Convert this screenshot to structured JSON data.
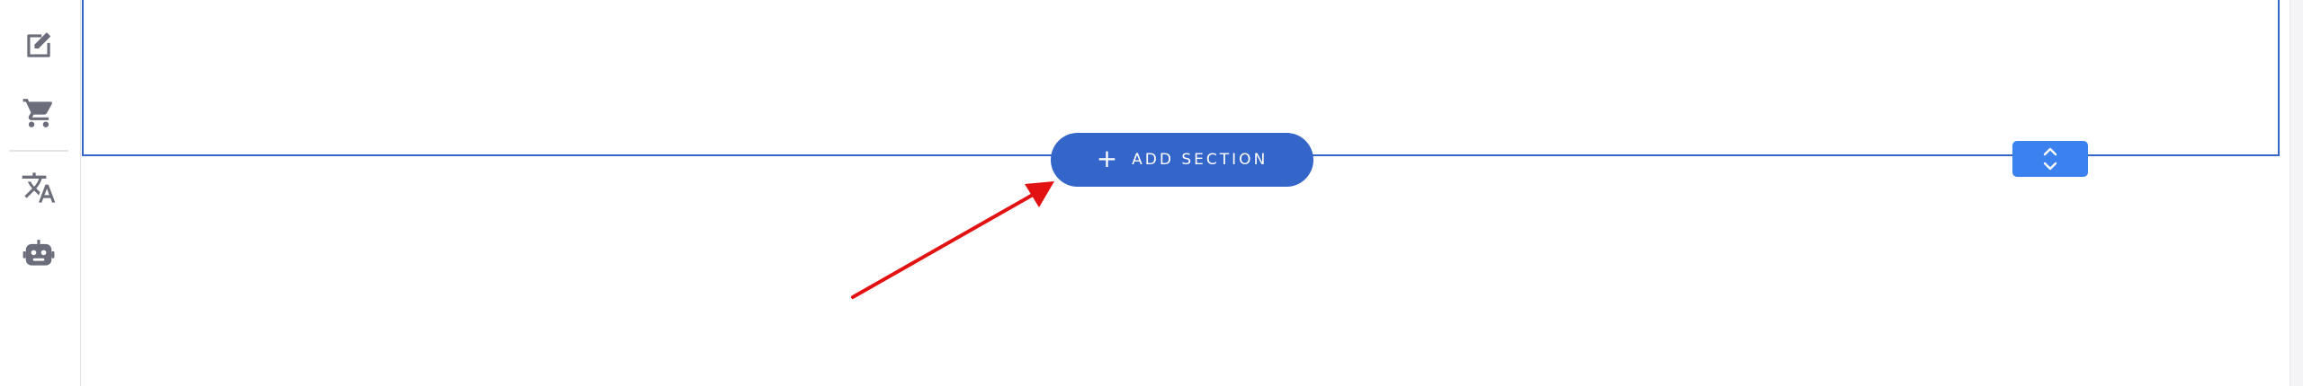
{
  "toolbar": {
    "items": [
      {
        "icon": "edit-note-icon"
      },
      {
        "icon": "cart-icon"
      },
      {
        "icon": "translate-icon"
      },
      {
        "icon": "robot-icon"
      }
    ]
  },
  "canvas": {
    "add_section": {
      "plus": "+",
      "label": "ADD SECTION"
    },
    "move_handle": {
      "icon": "chevron-up-down-icon"
    }
  },
  "colors": {
    "accent": "#3466c9",
    "handle": "#3b82f0",
    "icon": "#6b6e7a",
    "annotation_arrow": "#e31212"
  }
}
